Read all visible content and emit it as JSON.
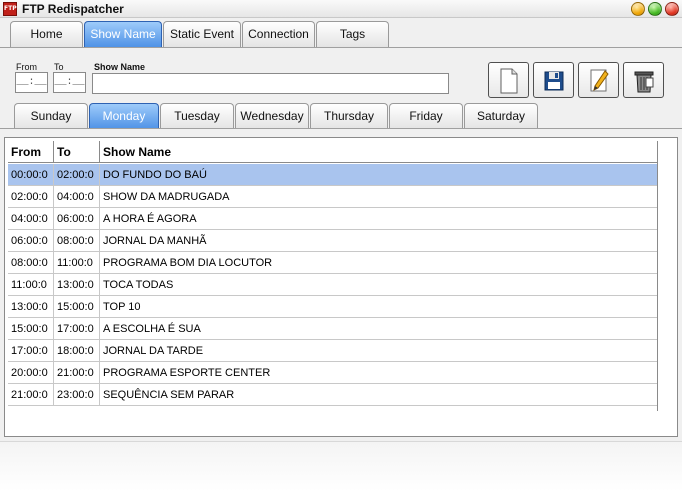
{
  "window": {
    "title": "FTP Redispatcher",
    "icon_text": "FTP"
  },
  "main_tabs": [
    {
      "label": "Home"
    },
    {
      "label": "Show Name",
      "active": true
    },
    {
      "label": "Static Event"
    },
    {
      "label": "Connection"
    },
    {
      "label": "Tags"
    }
  ],
  "form": {
    "from_label": "From",
    "to_label": "To",
    "show_name_label": "Show Name",
    "from_value": "__:__",
    "to_value": "__:__",
    "show_name_value": ""
  },
  "toolbar": {
    "new_icon": "document-icon",
    "save_icon": "floppy-disk-icon",
    "edit_icon": "pencil-edit-icon",
    "delete_icon": "trash-bin-icon"
  },
  "day_tabs": [
    {
      "label": "Sunday"
    },
    {
      "label": "Monday",
      "active": true
    },
    {
      "label": "Tuesday"
    },
    {
      "label": "Wednesday"
    },
    {
      "label": "Thursday"
    },
    {
      "label": "Friday"
    },
    {
      "label": "Saturday"
    }
  ],
  "grid": {
    "columns": [
      "From",
      "To",
      "Show Name"
    ],
    "rows": [
      {
        "from": "00:00:0",
        "to": "02:00:0",
        "name": "DO FUNDO DO BAÚ",
        "selected": true
      },
      {
        "from": "02:00:0",
        "to": "04:00:0",
        "name": "SHOW DA MADRUGADA"
      },
      {
        "from": "04:00:0",
        "to": "06:00:0",
        "name": "A HORA É AGORA"
      },
      {
        "from": "06:00:0",
        "to": "08:00:0",
        "name": "JORNAL DA MANHÃ"
      },
      {
        "from": "08:00:0",
        "to": "11:00:0",
        "name": "PROGRAMA BOM DIA LOCUTOR"
      },
      {
        "from": "11:00:0",
        "to": "13:00:0",
        "name": "TOCA TODAS"
      },
      {
        "from": "13:00:0",
        "to": "15:00:0",
        "name": "TOP 10"
      },
      {
        "from": "15:00:0",
        "to": "17:00:0",
        "name": "A ESCOLHA É SUA"
      },
      {
        "from": "17:00:0",
        "to": "18:00:0",
        "name": "JORNAL DA TARDE"
      },
      {
        "from": "20:00:0",
        "to": "21:00:0",
        "name": "PROGRAMA ESPORTE CENTER"
      },
      {
        "from": "21:00:0",
        "to": "23:00:0",
        "name": "SEQUÊNCIA SEM PARAR"
      }
    ]
  },
  "colors": {
    "active_tab": "#4f92e6",
    "selected_row": "#a9c4ee",
    "close": "#e0301c",
    "maximize": "#3fb61d",
    "minimize": "#f0a400"
  }
}
